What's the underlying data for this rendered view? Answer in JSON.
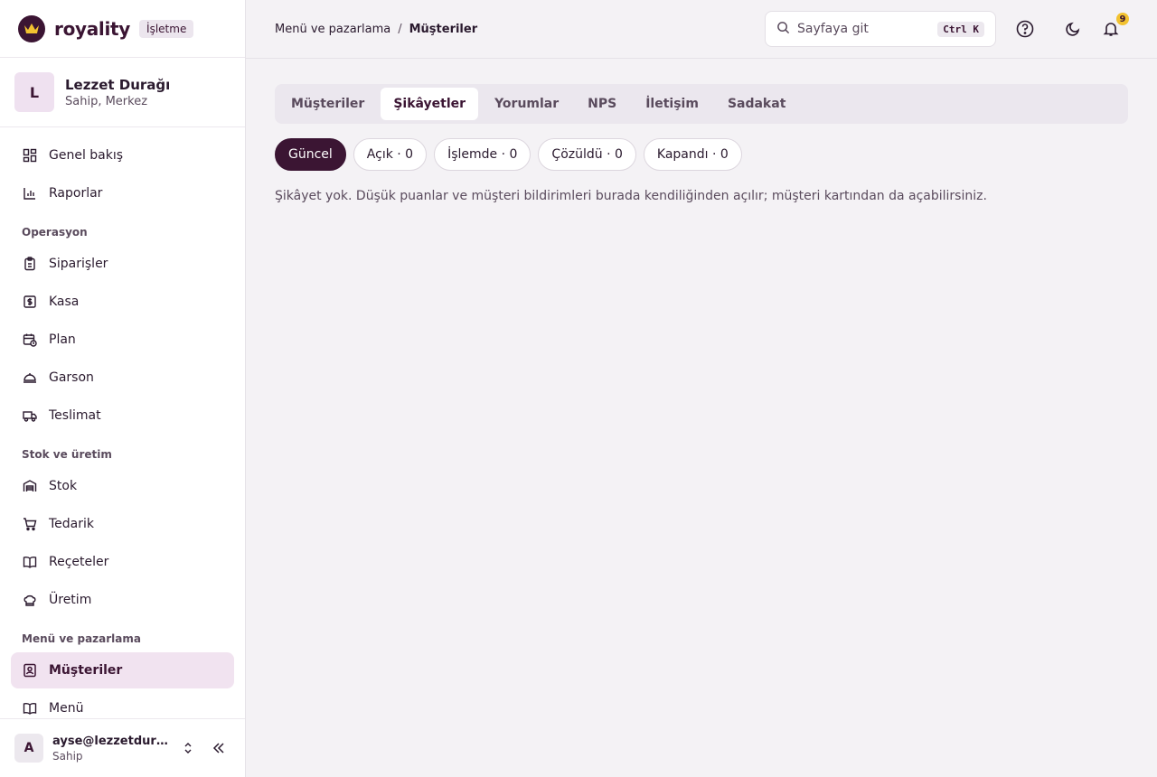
{
  "brand": {
    "name": "royality",
    "tag": "İşletme"
  },
  "org": {
    "avatar": "L",
    "name": "Lezzet Durağı",
    "role": "Sahip, Merkez"
  },
  "nav": {
    "general": [
      {
        "label": "Genel bakış",
        "icon": "dashboard-icon"
      },
      {
        "label": "Raporlar",
        "icon": "bar-chart-icon"
      }
    ],
    "section_ops": "Operasyon",
    "ops": [
      {
        "label": "Siparişler",
        "icon": "clipboard-icon"
      },
      {
        "label": "Kasa",
        "icon": "cash-register-icon"
      },
      {
        "label": "Plan",
        "icon": "calendar-clock-icon"
      },
      {
        "label": "Garson",
        "icon": "waiter-icon"
      },
      {
        "label": "Teslimat",
        "icon": "truck-icon"
      }
    ],
    "section_stock": "Stok ve üretim",
    "stock": [
      {
        "label": "Stok",
        "icon": "warehouse-icon"
      },
      {
        "label": "Tedarik",
        "icon": "cart-icon"
      },
      {
        "label": "Reçeteler",
        "icon": "book-icon"
      },
      {
        "label": "Üretim",
        "icon": "chef-hat-icon"
      }
    ],
    "section_menu": "Menü ve pazarlama",
    "menu": [
      {
        "label": "Müşteriler",
        "icon": "contact-icon"
      },
      {
        "label": "Menü",
        "icon": "menu-icon"
      }
    ]
  },
  "user": {
    "avatar": "A",
    "email": "ayse@lezzetduragi.com",
    "role": "Sahip"
  },
  "breadcrumb": {
    "parent": "Menü ve pazarlama",
    "separator": "/",
    "current": "Müşteriler"
  },
  "search": {
    "placeholder": "Sayfaya git",
    "shortcut": "Ctrl K"
  },
  "notifications": {
    "count": "9"
  },
  "tabs": [
    "Müşteriler",
    "Şikâyetler",
    "Yorumlar",
    "NPS",
    "İletişim",
    "Sadakat"
  ],
  "filters": [
    "Güncel",
    "Açık · 0",
    "İşlemde · 0",
    "Çözüldü · 0",
    "Kapandı · 0"
  ],
  "empty_message": "Şikâyet yok. Düşük puanlar ve müşteri bildirimleri burada kendiliğinden açılır; müşteri kartından da açabilirsiniz.",
  "colors": {
    "brand": "#3b1533",
    "active_nav": "#f1e3f0",
    "badge": "#f2c230"
  }
}
